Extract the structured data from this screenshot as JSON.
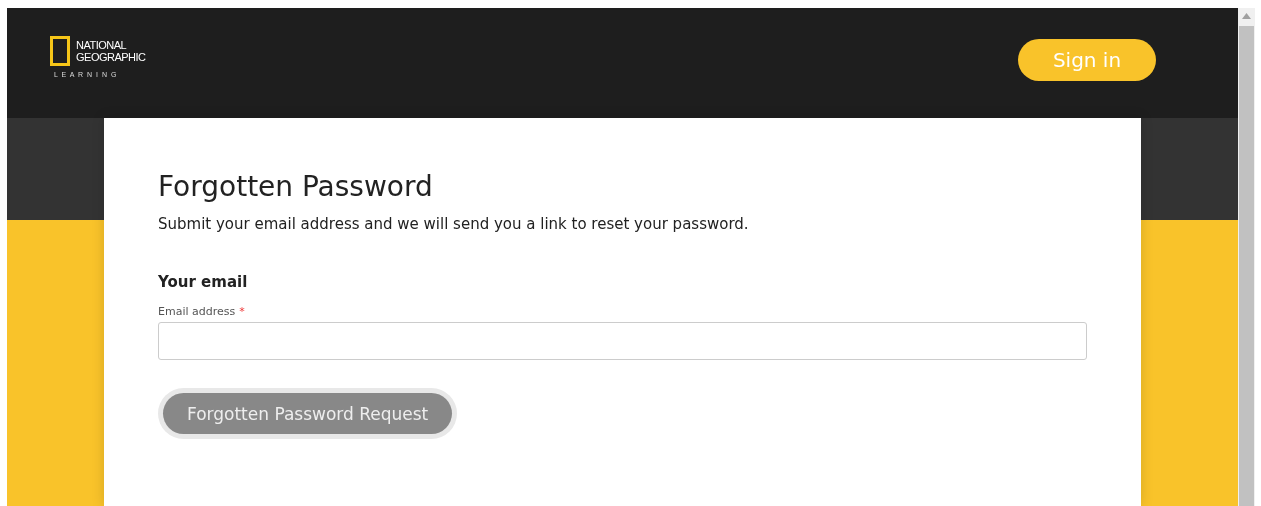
{
  "header": {
    "logo": {
      "line_1": "NATIONAL",
      "line_2": "GEOGRAPHIC",
      "line_3": "L E A R N I N G"
    },
    "sign_in_button": "Sign in"
  },
  "form": {
    "title": "Forgotten Password",
    "intro": "Submit your email address and we will send you a link to reset your password.",
    "section_heading": "Your email",
    "email_field": {
      "label": "Email address",
      "required_mark": "*"
    },
    "submit_button": {
      "label": "Forgotten Password Request",
      "disabled": true
    }
  }
}
